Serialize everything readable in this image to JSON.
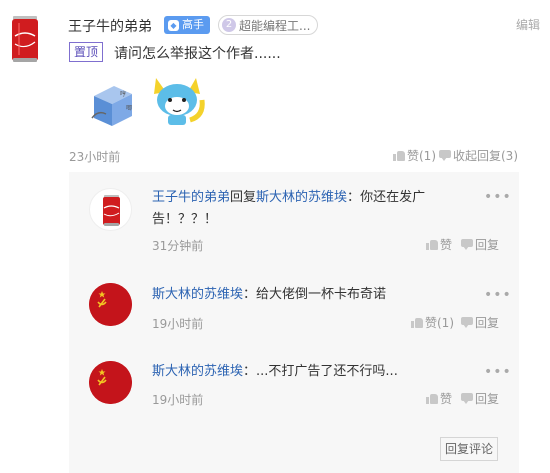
{
  "post": {
    "author": "王子牛的弟弟",
    "badge_label": "高手",
    "level_number": "2",
    "level_label": "超能编程工...",
    "edit_label": "编辑",
    "pinned_label": "置顶",
    "text": "请问怎么举报这个作者......",
    "time": "23小时前",
    "like_label": "赞(1)",
    "fold_label": "收起回复(3)"
  },
  "stickers": {
    "sticker1": "sticker-cube",
    "sticker2": "sticker-cat"
  },
  "replies": [
    {
      "author": "王子牛的弟弟",
      "verb": "回复",
      "target": "斯大林的苏维埃",
      "sep": "：",
      "text_line1": "你还在发广",
      "text_line2": "告！？？！",
      "time": "31分钟前",
      "like_label": "赞",
      "reply_label": "回复",
      "more": "•••"
    },
    {
      "author": "斯大林的苏维埃",
      "sep": "：",
      "text": "给大佬倒一杯卡布奇诺",
      "time": "19小时前",
      "like_label": "赞(1)",
      "reply_label": "回复",
      "more": "•••"
    },
    {
      "author": "斯大林的苏维埃",
      "sep": "：",
      "text": "...不打广告了还不行吗...",
      "time": "19小时前",
      "like_label": "赞",
      "reply_label": "回复",
      "more": "•••"
    }
  ],
  "reply_comment_button": "回复评论",
  "colors": {
    "link": "#2d64b3",
    "badge": "#5b9bf0",
    "pinned": "#7f6fcf",
    "coke_red": "#d01c1f",
    "soviet_red": "#c4141b"
  },
  "icons": {
    "like": "thumbs-up-icon",
    "reply": "reply-icon",
    "more": "more-dots-icon"
  }
}
